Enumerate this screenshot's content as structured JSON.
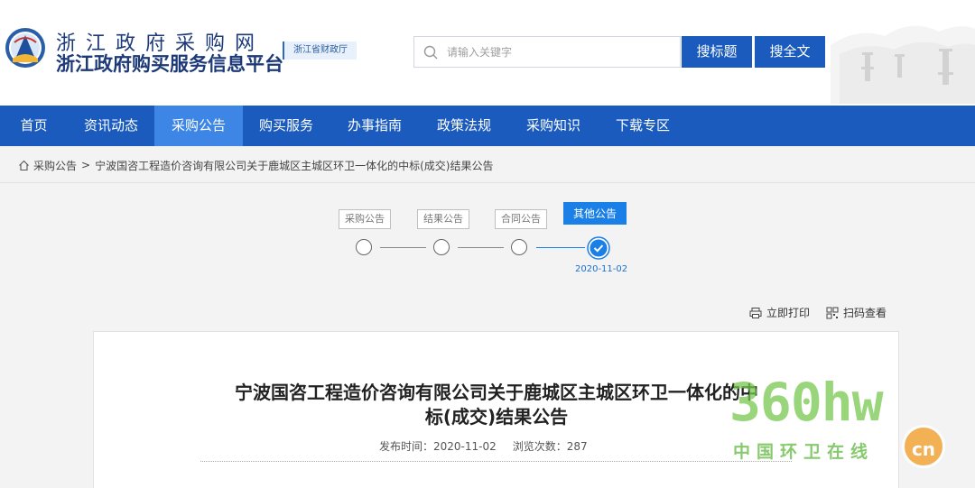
{
  "header": {
    "site_title_line1": "浙江政府采购网",
    "site_title_line2": "浙江政府购买服务信息平台",
    "dept_badge": "浙江省财政厅",
    "search_placeholder": "请输入关键字",
    "btn_search_title": "搜标题",
    "btn_search_full": "搜全文"
  },
  "nav": {
    "items": [
      {
        "label": "首页"
      },
      {
        "label": "资讯动态"
      },
      {
        "label": "采购公告",
        "active": true
      },
      {
        "label": "购买服务"
      },
      {
        "label": "办事指南"
      },
      {
        "label": "政策法规"
      },
      {
        "label": "采购知识"
      },
      {
        "label": "下载专区"
      }
    ]
  },
  "breadcrumb": {
    "home": "采购公告",
    "separator": ">",
    "current": "宁波国咨工程造价咨询有限公司关于鹿城区主城区环卫一体化的中标(成交)结果公告"
  },
  "steps": {
    "items": [
      {
        "label": "采购公告"
      },
      {
        "label": "结果公告"
      },
      {
        "label": "合同公告"
      },
      {
        "label": "其他公告",
        "active": true
      }
    ],
    "date": "2020-11-02"
  },
  "tools": {
    "print": "立即打印",
    "qr": "扫码查看"
  },
  "document": {
    "title_line1": "宁波国咨工程造价咨询有限公司关于鹿城区主城区环卫一体化的中",
    "title_line2": "标(成交)结果公告",
    "publish_label": "发布时间：",
    "publish_date": "2020-11-02",
    "views_label": "浏览次数：",
    "views_count": "287"
  },
  "watermark": {
    "brand": "360hw",
    "tagline": "中国环卫在线",
    "badge": "cn"
  },
  "colors": {
    "primary": "#1a5bbd",
    "nav_active": "#3d86e6",
    "step_active": "#1a7fe6"
  }
}
